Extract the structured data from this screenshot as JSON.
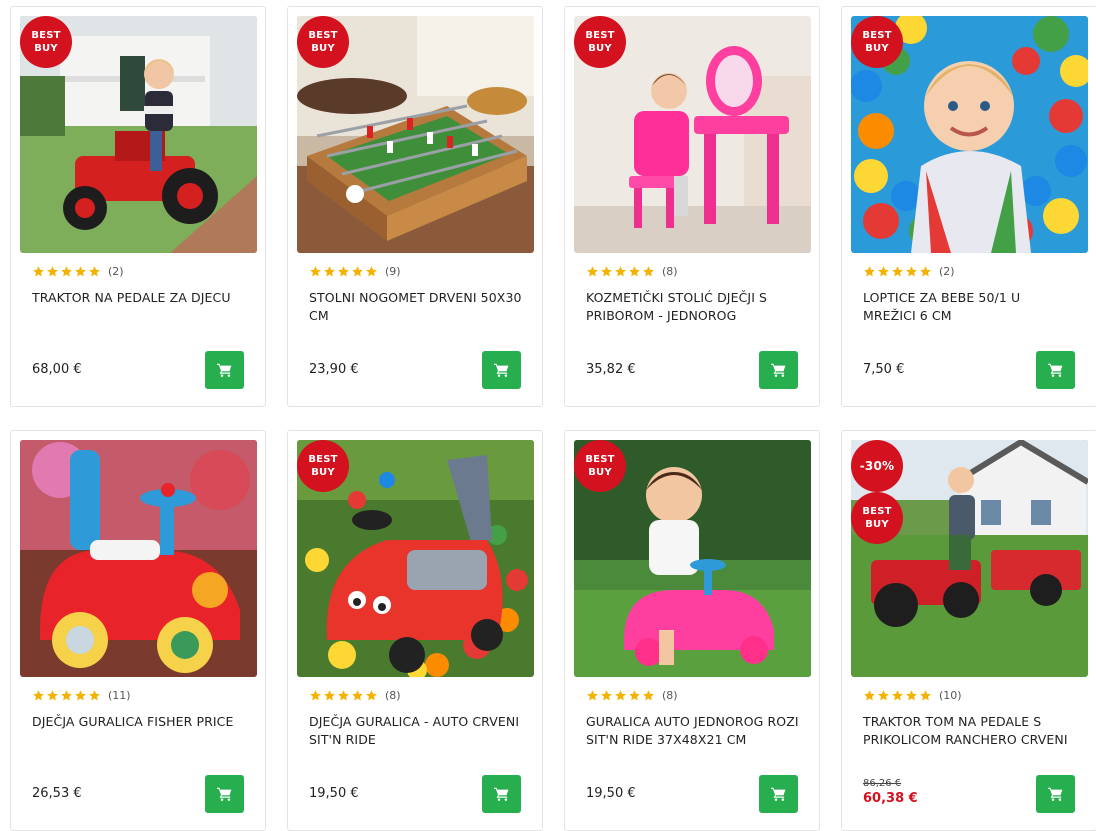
{
  "products": [
    {
      "title": "Traktor na pedale za djecu",
      "rating_count": "(2)",
      "price": "68,00 €",
      "badge_primary": "BEST BUY",
      "image_subject": "child on red pedal tractor"
    },
    {
      "title": "Stolni nogomet drveni 50x30 cm",
      "rating_count": "(9)",
      "price": "23,90 €",
      "badge_primary": "BEST BUY",
      "image_subject": "wooden table football"
    },
    {
      "title": "Kozmetički stolić dječji s priborom - jednorog",
      "rating_count": "(8)",
      "price": "35,82 €",
      "badge_primary": "BEST BUY",
      "image_subject": "girl at pink vanity table"
    },
    {
      "title": "Loptice za bebe 50/1 u mrežici 6 cm",
      "rating_count": "(2)",
      "price": "7,50 €",
      "badge_primary": "BEST BUY",
      "image_subject": "child in colorful ball pit"
    },
    {
      "title": "Dječja guralica Fisher Price",
      "rating_count": "(11)",
      "price": "26,53 €",
      "image_subject": "red ride-on toy car"
    },
    {
      "title": "Dječja guralica - auto crveni Sit'n Ride",
      "rating_count": "(8)",
      "price": "19,50 €",
      "badge_primary": "BEST BUY",
      "image_subject": "red ride-on car on grass with balls"
    },
    {
      "title": "Guralica auto jednorog rozi Sit'n Ride 37x48x21 cm",
      "rating_count": "(8)",
      "price": "19,50 €",
      "badge_primary": "BEST BUY",
      "image_subject": "toddler on pink ride-on car"
    },
    {
      "title": "Traktor Tom na pedale s prikolicom Ranchero crveni",
      "rating_count": "(10)",
      "old_price": "86,26 €",
      "price": "60,38 €",
      "badge_primary": "-30%",
      "badge_secondary": "BEST BUY",
      "image_subject": "child on red tractor with trailer"
    }
  ],
  "rating_stars": 5,
  "colors": {
    "badge": "#d4111f",
    "cart_button": "#27ae4f",
    "star": "#f5b301",
    "sale_price": "#d4111f"
  },
  "icons": {
    "cart": "shopping-cart-icon",
    "star": "star-icon"
  }
}
